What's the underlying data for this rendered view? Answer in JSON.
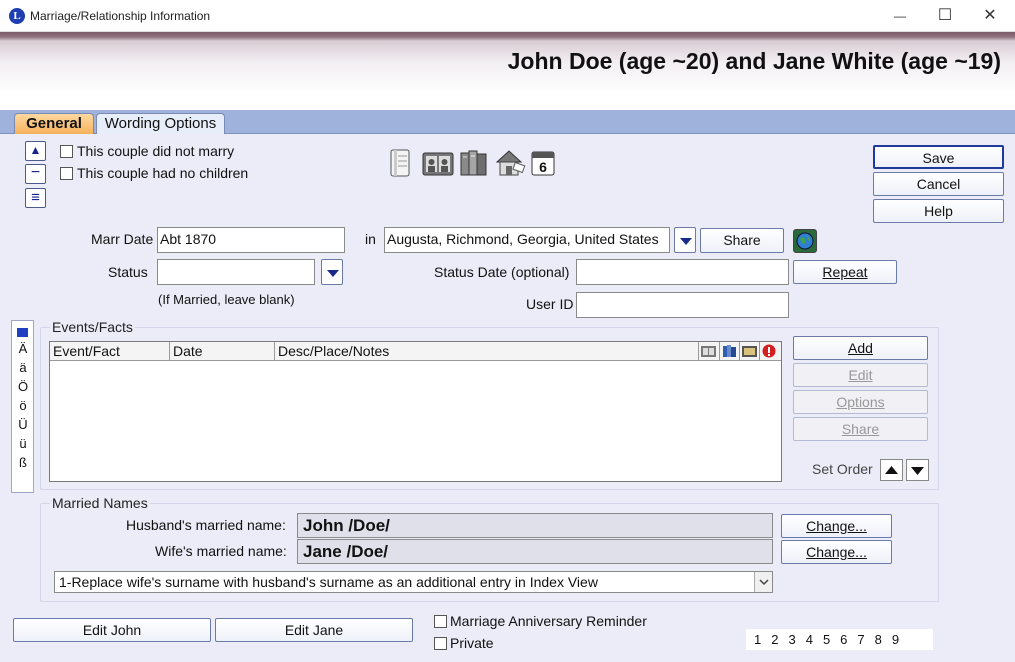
{
  "window": {
    "title": "Marriage/Relationship Information",
    "app_icon": "L",
    "minimize": "—",
    "maximize": "☐",
    "close": "✕"
  },
  "header": {
    "title": "John Doe (age ~20) and Jane White (age ~19)"
  },
  "tabs": [
    {
      "label": "General",
      "active": true
    },
    {
      "label": "Wording Options",
      "active": false
    }
  ],
  "side_controls": {
    "up": "▲",
    "minus": "−",
    "menu": "≡"
  },
  "checkboxes": {
    "did_not_marry": "This couple did not marry",
    "no_children": "This couple had no children"
  },
  "toolbar_icons": [
    "notes-icon",
    "media-icon",
    "sources-icon",
    "address-icon",
    "calendar-icon"
  ],
  "calendar_icon_number": "6",
  "actions": {
    "save": "Save",
    "cancel": "Cancel",
    "help": "Help"
  },
  "marriage": {
    "date_label": "Marr Date",
    "date_value": "Abt 1870",
    "in_label": "in",
    "place_value": "Augusta, Richmond, Georgia, United States",
    "share": "Share",
    "status_label": "Status",
    "status_value": "",
    "status_hint": "(If Married, leave blank)",
    "status_date_label": "Status Date (optional)",
    "status_date_value": "",
    "repeat": "Repeat",
    "user_id_label": "User ID",
    "user_id_value": ""
  },
  "special_chars": [
    "Ä",
    "ä",
    "Ö",
    "ö",
    "Ü",
    "ü",
    "ß"
  ],
  "events": {
    "title": "Events/Facts",
    "columns": [
      "Event/Fact",
      "Date",
      "Desc/Place/Notes"
    ],
    "rows": [],
    "buttons": {
      "add": "Add",
      "edit": "Edit",
      "options": "Options",
      "share": "Share"
    },
    "set_order": "Set Order"
  },
  "married_names": {
    "title": "Married Names",
    "husband_label": "Husband's married name:",
    "husband_value": "John /Doe/",
    "wife_label": "Wife's married name:",
    "wife_value": "Jane /Doe/",
    "change": "Change...",
    "option_selected": "1-Replace wife's surname with husband's surname as an additional entry in Index View"
  },
  "bottom": {
    "edit_john": "Edit John",
    "edit_jane": "Edit Jane",
    "reminder": "Marriage Anniversary Reminder",
    "private": "Private",
    "pages": [
      "1",
      "2",
      "3",
      "4",
      "5",
      "6",
      "7",
      "8",
      "9"
    ]
  },
  "colors": {
    "accent": "#1a2a8a",
    "tab_active": "#f6b25d",
    "tab_bar": "#9fb2db",
    "panel": "#ececf8"
  }
}
